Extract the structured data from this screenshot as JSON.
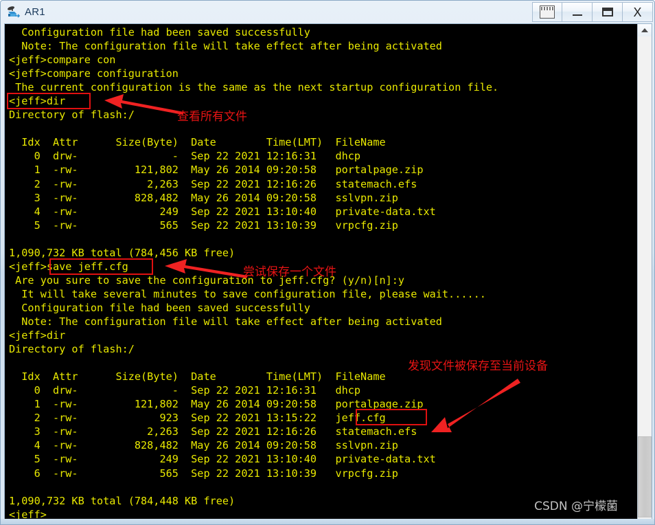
{
  "window": {
    "title": "AR1",
    "icon": "router-icon",
    "buttons": [
      {
        "name": "capture-button",
        "label": "",
        "icon": "capture-icon"
      },
      {
        "name": "minimize-button",
        "label": "",
        "icon": "minimize-icon"
      },
      {
        "name": "maximize-button",
        "label": "",
        "icon": "maximize-icon"
      },
      {
        "name": "close-button",
        "label": "X",
        "icon": "close-icon"
      }
    ]
  },
  "terminal": {
    "fg_color": "#e8e800",
    "bg_color": "#000000",
    "lines": [
      "  Configuration file had been saved successfully",
      "  Note: The configuration file will take effect after being activated",
      "<jeff>compare con",
      "<jeff>compare configuration",
      " The current configuration is the same as the next startup configuration file.",
      "<jeff>dir",
      "Directory of flash:/",
      "",
      "  Idx  Attr      Size(Byte)  Date        Time(LMT)  FileName",
      "    0  drw-               -  Sep 22 2021 12:16:31   dhcp",
      "    1  -rw-         121,802  May 26 2014 09:20:58   portalpage.zip",
      "    2  -rw-           2,263  Sep 22 2021 12:16:26   statemach.efs",
      "    3  -rw-         828,482  May 26 2014 09:20:58   sslvpn.zip",
      "    4  -rw-             249  Sep 22 2021 13:10:40   private-data.txt",
      "    5  -rw-             565  Sep 22 2021 13:10:39   vrpcfg.zip",
      "",
      "1,090,732 KB total (784,456 KB free)",
      "<jeff>save jeff.cfg",
      " Are you sure to save the configuration to jeff.cfg? (y/n)[n]:y",
      "  It will take several minutes to save configuration file, please wait......",
      "  Configuration file had been saved successfully",
      "  Note: The configuration file will take effect after being activated",
      "<jeff>dir",
      "Directory of flash:/",
      "",
      "  Idx  Attr      Size(Byte)  Date        Time(LMT)  FileName",
      "    0  drw-               -  Sep 22 2021 12:16:31   dhcp",
      "    1  -rw-         121,802  May 26 2014 09:20:58   portalpage.zip",
      "    2  -rw-             923  Sep 22 2021 13:15:22   jeff.cfg",
      "    3  -rw-           2,263  Sep 22 2021 12:16:26   statemach.efs",
      "    4  -rw-         828,482  May 26 2014 09:20:58   sslvpn.zip",
      "    5  -rw-             249  Sep 22 2021 13:10:40   private-data.txt",
      "    6  -rw-             565  Sep 22 2021 13:10:39   vrpcfg.zip",
      "",
      "1,090,732 KB total (784,448 KB free)",
      "<jeff>"
    ]
  },
  "annotations": {
    "color": "#e81414",
    "notes": [
      {
        "name": "annotation-view-all-files",
        "text": "查看所有文件"
      },
      {
        "name": "annotation-try-save-file",
        "text": "尝试保存一个文件"
      },
      {
        "name": "annotation-file-saved-to-device",
        "text": "发现文件被保存至当前设备"
      }
    ],
    "highlight_boxes": [
      {
        "name": "highlight-dir-command",
        "target": "<jeff>dir"
      },
      {
        "name": "highlight-save-command",
        "target": "save jeff.cfg"
      },
      {
        "name": "highlight-jeff-cfg-file",
        "target": "jeff.cfg"
      }
    ]
  },
  "watermark": {
    "text": "CSDN @宁檬菌"
  },
  "scrollbar": {
    "up_arrow": "chevron-up-icon",
    "thumb_position": "near-bottom"
  }
}
